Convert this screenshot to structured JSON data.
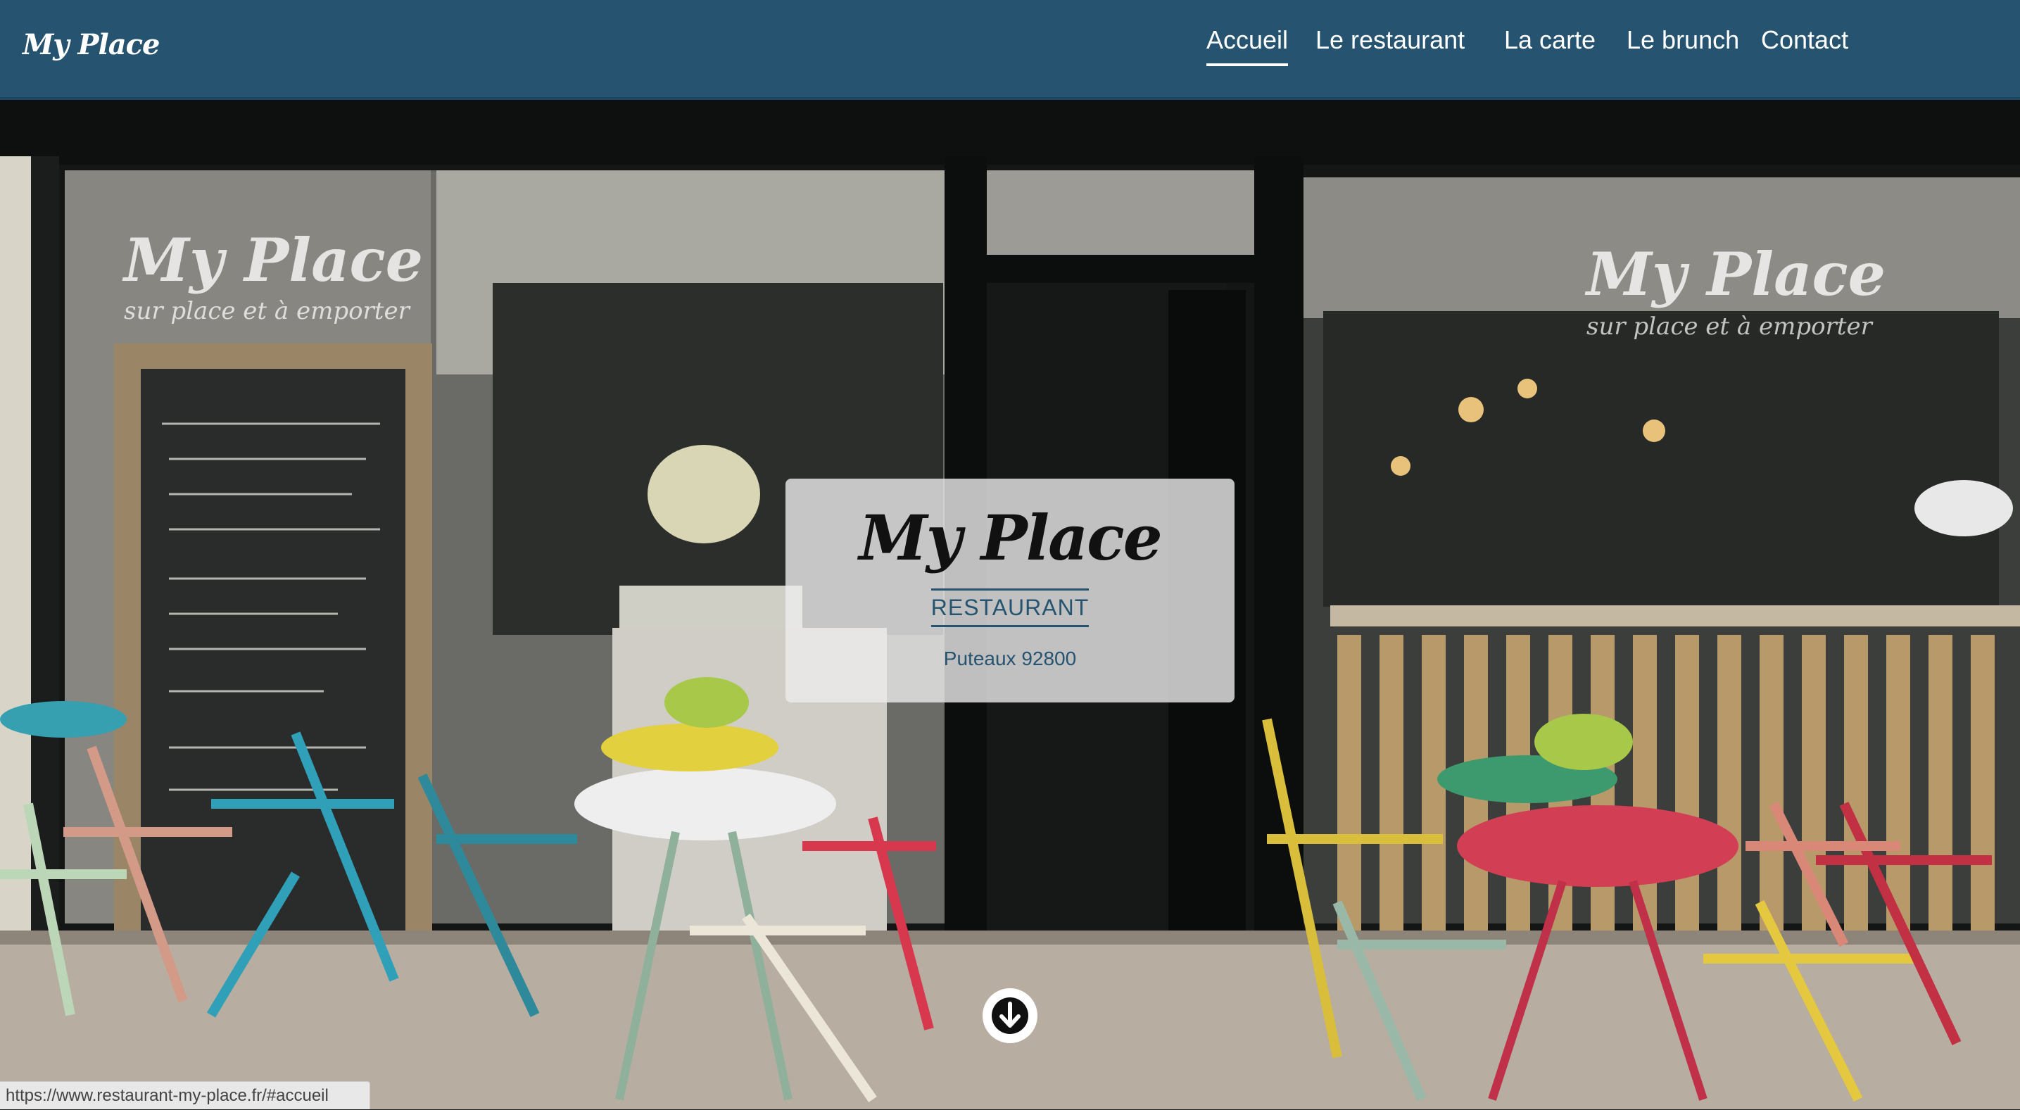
{
  "header": {
    "logo": "My Place",
    "nav": [
      {
        "label": "Accueil",
        "active": true
      },
      {
        "label": "Le restaurant",
        "active": false
      },
      {
        "label": "La carte",
        "active": false
      },
      {
        "label": "Le brunch",
        "active": false
      },
      {
        "label": "Contact",
        "active": false
      }
    ]
  },
  "hero": {
    "title": "My Place",
    "subtitle": "RESTAURANT",
    "location": "Puteaux 92800",
    "scroll_icon": "arrow-down-circle-icon",
    "window_lettering": {
      "name": "My Place",
      "tagline": "sur place et à emporter"
    }
  },
  "status_bar": {
    "url": "https://www.restaurant-my-place.fr/#accueil"
  },
  "colors": {
    "header_bg": "#26536f",
    "accent": "#26536f",
    "nav_text": "#ffffff"
  }
}
